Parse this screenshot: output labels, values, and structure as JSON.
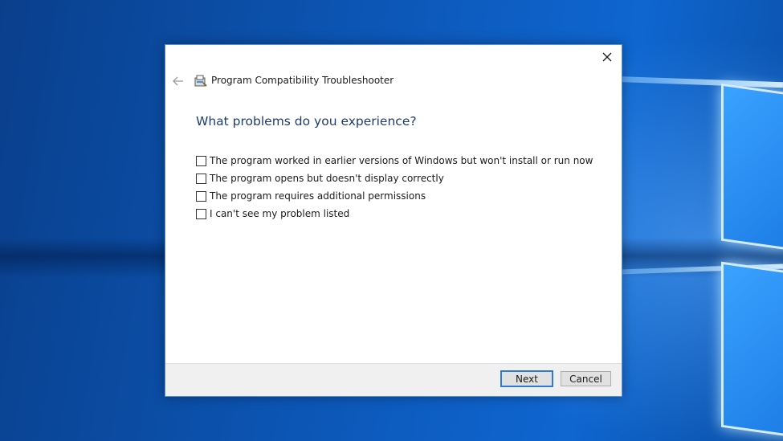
{
  "dialog": {
    "title": "Program Compatibility Troubleshooter",
    "question": "What problems do you experience?",
    "options": [
      "The program worked in earlier versions of Windows but won't install or run now",
      "The program opens but doesn't display correctly",
      "The program requires additional permissions",
      "I can't see my problem listed"
    ],
    "buttons": {
      "next": "Next",
      "cancel": "Cancel"
    }
  },
  "icons": {
    "close": "close-icon",
    "back": "back-arrow-icon",
    "app": "troubleshooter-icon"
  },
  "colors": {
    "question_text": "#1e3d6e",
    "primary_button_border": "#2b7ad6",
    "desktop_blue": "#0b4fa8"
  }
}
